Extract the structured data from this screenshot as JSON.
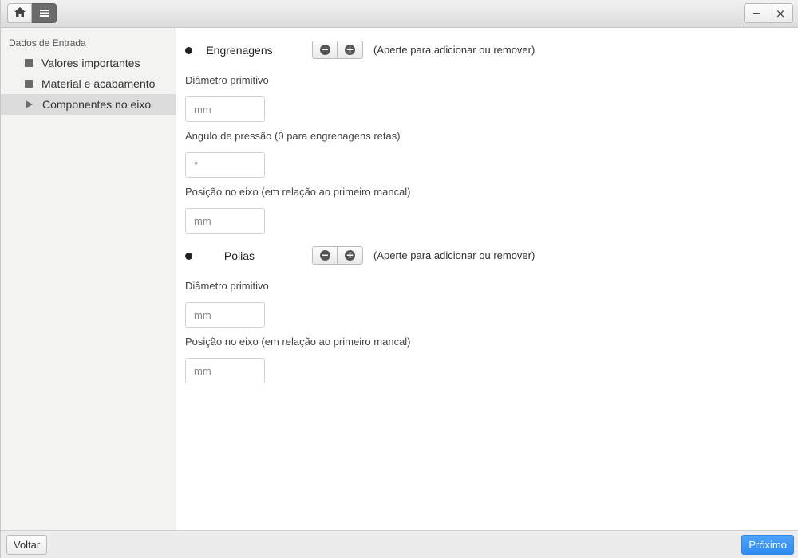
{
  "sidebar": {
    "header": "Dados de Entrada",
    "items": [
      {
        "label": "Valores importantes",
        "active": false
      },
      {
        "label": "Material e acabamento",
        "active": false
      },
      {
        "label": "Componentes no eixo",
        "active": true
      }
    ]
  },
  "gears": {
    "title": "Engrenagens",
    "hint": "(Aperte para adicionar ou remover)",
    "remove_icon": "minus-circle-icon",
    "add_icon": "plus-circle-icon",
    "fields": [
      {
        "label": "Diâmetro primitivo",
        "placeholder": "mm"
      },
      {
        "label": "Angulo de pressão (0 para engrenagens retas)",
        "placeholder": "°"
      },
      {
        "label": "Posição no eixo (em relação ao primeiro mancal)",
        "placeholder": "mm"
      }
    ]
  },
  "pulleys": {
    "title": "Polias",
    "hint": "(Aperte para adicionar ou remover)",
    "fields": [
      {
        "label": "Diâmetro primitivo",
        "placeholder": "mm"
      },
      {
        "label": "Posição no eixo (em relação ao primeiro mancal)",
        "placeholder": "mm"
      }
    ]
  },
  "footer": {
    "back_label": "Voltar",
    "next_label": "Próximo"
  },
  "titlebar": {
    "minimize_symbol": "−",
    "close_symbol": "×"
  },
  "colors": {
    "accent": "#2d8cf0",
    "sidebar_bg": "#f3f3f2",
    "sidebar_active": "#dcdcdc"
  }
}
